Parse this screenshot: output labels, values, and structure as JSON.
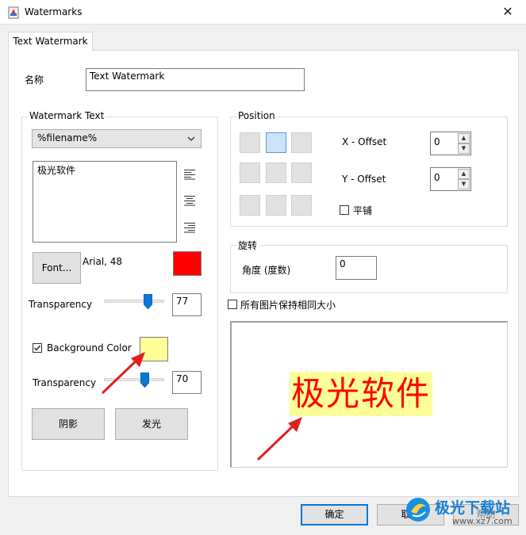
{
  "window": {
    "title": "Watermarks",
    "close_glyph": "✕"
  },
  "tabs": [
    {
      "label": "Text Watermark"
    }
  ],
  "name": {
    "label": "名称",
    "value": "Text Watermark"
  },
  "watermark_text": {
    "group_title": "Watermark Text",
    "combo_value": "%filename%",
    "text_value": "极光软件",
    "font_button": "Font...",
    "font_desc": "Arial, 48",
    "text_color": "#ff0000",
    "transparency_label": "Transparency",
    "transparency_value": "77",
    "transparency_level": 77,
    "bg_checkbox_label": "Background Color",
    "bg_checked": true,
    "bg_color": "#ffff99",
    "bg_transparency_label": "Transparency",
    "bg_transparency_value": "70",
    "bg_transparency_level": 70,
    "shadow_button": "阴影",
    "glow_button": "发光"
  },
  "position": {
    "group_title": "Position",
    "selected_cell": 1,
    "x_offset_label": "X - Offset",
    "x_offset_value": "0",
    "y_offset_label": "Y - Offset",
    "y_offset_value": "0",
    "tile_label": "平铺"
  },
  "rotation": {
    "group_title": "旋转",
    "angle_label": "角度 (度数)",
    "angle_value": "0"
  },
  "same_size_label": "所有图片保持相同大小",
  "preview": {
    "text": "极光软件",
    "text_color": "#ff0000",
    "bg_color": "#ffff99"
  },
  "footer": {
    "ok": "确定",
    "cancel": "取消",
    "help": "帮助"
  },
  "watermark_brand": {
    "site_cn": "极光下载站",
    "site_url": "www.xz7.com"
  }
}
